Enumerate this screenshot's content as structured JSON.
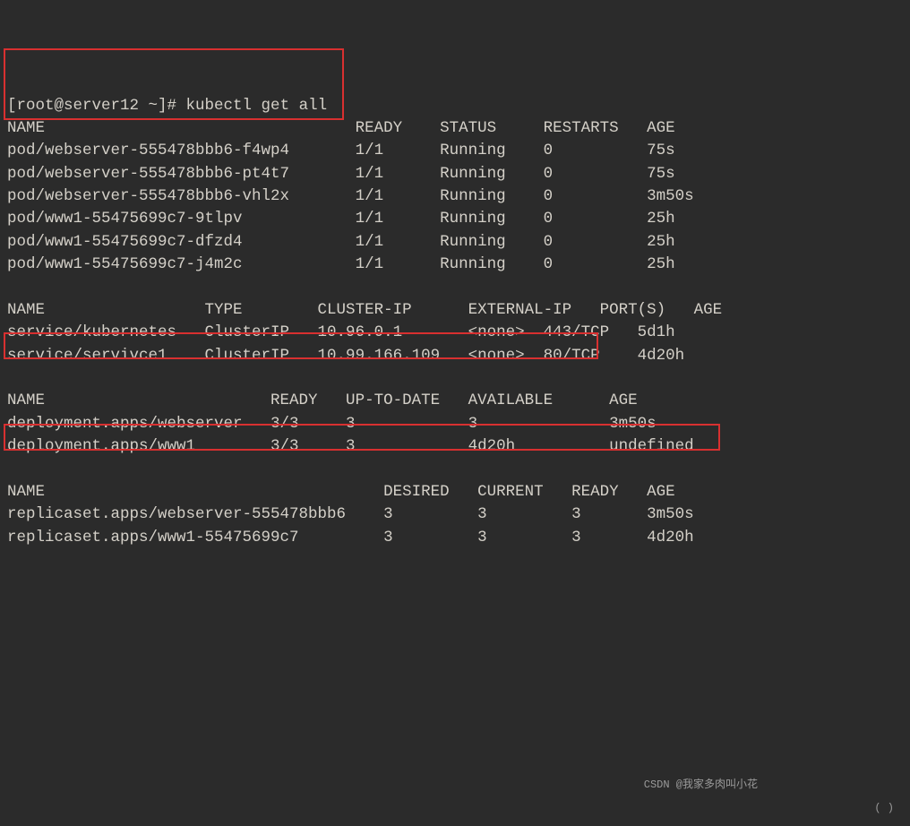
{
  "prompt": "[root@server12 ~]# ",
  "command": "kubectl get all",
  "pods": {
    "header": {
      "name": "NAME",
      "ready": "READY",
      "status": "STATUS",
      "restarts": "RESTARTS",
      "age": "AGE"
    },
    "rows": [
      {
        "name": "pod/webserver-555478bbb6-f4wp4",
        "ready": "1/1",
        "status": "Running",
        "restarts": "0",
        "age": "75s"
      },
      {
        "name": "pod/webserver-555478bbb6-pt4t7",
        "ready": "1/1",
        "status": "Running",
        "restarts": "0",
        "age": "75s"
      },
      {
        "name": "pod/webserver-555478bbb6-vhl2x",
        "ready": "1/1",
        "status": "Running",
        "restarts": "0",
        "age": "3m50s"
      },
      {
        "name": "pod/www1-55475699c7-9tlpv",
        "ready": "1/1",
        "status": "Running",
        "restarts": "0",
        "age": "25h"
      },
      {
        "name": "pod/www1-55475699c7-dfzd4",
        "ready": "1/1",
        "status": "Running",
        "restarts": "0",
        "age": "25h"
      },
      {
        "name": "pod/www1-55475699c7-j4m2c",
        "ready": "1/1",
        "status": "Running",
        "restarts": "0",
        "age": "25h"
      }
    ]
  },
  "services": {
    "header": {
      "name": "NAME",
      "type": "TYPE",
      "cluster_ip": "CLUSTER-IP",
      "external_ip": "EXTERNAL-IP",
      "ports": "PORT(S)",
      "age": "AGE"
    },
    "rows": [
      {
        "name": "service/kubernetes",
        "type": "ClusterIP",
        "cluster_ip": "10.96.0.1",
        "external_ip": "<none>",
        "ports": "443/TCP",
        "age": "5d1h"
      },
      {
        "name": "service/servivce1",
        "type": "ClusterIP",
        "cluster_ip": "10.99.166.109",
        "external_ip": "<none>",
        "ports": "80/TCP",
        "age": "4d20h"
      }
    ]
  },
  "deployments": {
    "header": {
      "name": "NAME",
      "ready": "READY",
      "up_to_date": "UP-TO-DATE",
      "available": "AVAILABLE",
      "age": "AGE"
    },
    "rows": [
      {
        "name": "deployment.apps/webserver",
        "ready": "3/3",
        "up_to_date": "3",
        "available": "3",
        "age": "3m50s"
      },
      {
        "name": "deployment.apps/www1",
        "ready": "3/3",
        "up_to_date": "3",
        "available": "4d20h"
      }
    ]
  },
  "replicasets": {
    "header": {
      "name": "NAME",
      "desired": "DESIRED",
      "current": "CURRENT",
      "ready": "READY",
      "age": "AGE"
    },
    "rows": [
      {
        "name": "replicaset.apps/webserver-555478bbb6",
        "desired": "3",
        "current": "3",
        "ready": "3",
        "age": "3m50s"
      },
      {
        "name": "replicaset.apps/www1-55475699c7",
        "desired": "3",
        "current": "3",
        "ready": "3",
        "age": "4d20h"
      }
    ]
  },
  "watermark1": "CSDN @我家多肉叫小花",
  "watermark2": "(     )"
}
